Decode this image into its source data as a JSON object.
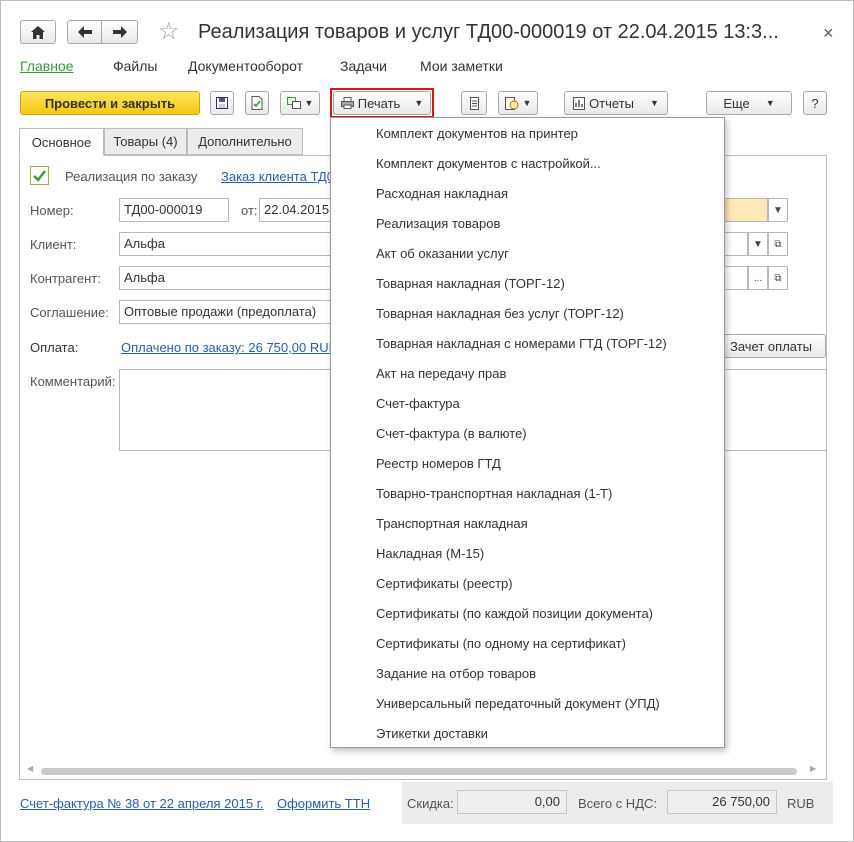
{
  "window": {
    "title": "Реализация товаров и услуг ТД00-000019 от 22.04.2015 13:3...",
    "close_glyph": "×"
  },
  "nav": {
    "items": [
      "Главное",
      "Файлы",
      "Документооборот",
      "Задачи",
      "Мои заметки"
    ]
  },
  "toolbar": {
    "post_close_label": "Провести и закрыть",
    "print_label": "Печать",
    "reports_label": "Отчеты",
    "more_label": "Еще",
    "help_label": "?",
    "print_highlight_color": "#d9161b"
  },
  "tabs": [
    "Основное",
    "Товары (4)",
    "Дополнительно"
  ],
  "form": {
    "by_order_label": "Реализация по заказу",
    "by_order_checked": true,
    "order_link": "Заказ клиента ТД0",
    "number_label": "Номер:",
    "number_value": "ТД00-000019",
    "date_label": "от:",
    "date_value": "22.04.2015",
    "client_label": "Клиент:",
    "client_value": "Альфа",
    "counterparty_label": "Контрагент:",
    "counterparty_value": "Альфа",
    "agreement_label": "Соглашение:",
    "agreement_value": "Оптовые продажи (предоплата)",
    "payment_label": "Оплата:",
    "payment_link": "Оплачено по заказу: 26 750,00 RUB",
    "offset_button": "Зачет оплаты",
    "comment_label": "Комментарий:",
    "comment_value": ""
  },
  "print_menu": {
    "items": [
      "Комплект документов на принтер",
      "Комплект документов с настройкой...",
      "Расходная накладная",
      "Реализация товаров",
      "Акт об оказании услуг",
      "Товарная накладная (ТОРГ-12)",
      "Товарная накладная без услуг (ТОРГ-12)",
      "Товарная накладная с номерами ГТД (ТОРГ-12)",
      "Акт на передачу прав",
      "Счет-фактура",
      "Счет-фактура (в валюте)",
      "Реестр номеров ГТД",
      "Товарно-транспортная накладная (1-Т)",
      "Транспортная накладная",
      "Накладная (М-15)",
      "Сертификаты (реестр)",
      "Сертификаты (по каждой позиции документа)",
      "Сертификаты (по одному на сертификат)",
      "Задание на отбор товаров",
      "Универсальный передаточный документ (УПД)",
      "Этикетки доставки"
    ]
  },
  "footer": {
    "invoice_link": "Счет-фактура № 38 от 22 апреля 2015 г.",
    "ttn_link": "Оформить ТТН",
    "discount_label": "Скидка:",
    "discount_value": "0,00",
    "total_label": "Всего с НДС:",
    "total_value": "26 750,00",
    "currency": "RUB"
  }
}
